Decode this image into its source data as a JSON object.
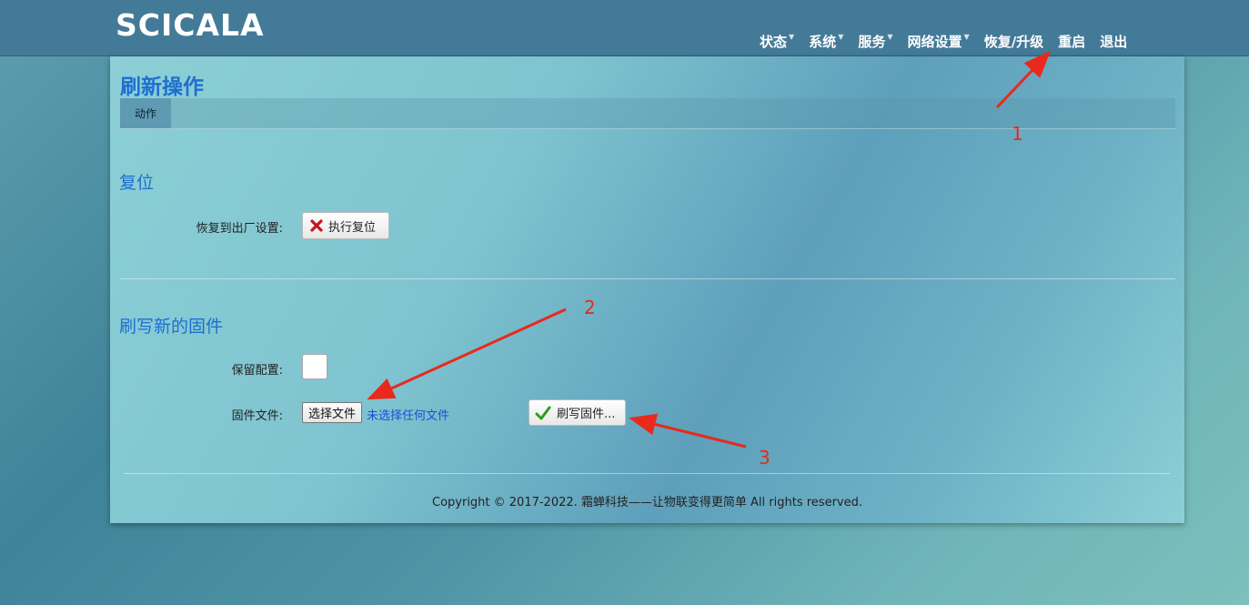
{
  "header": {
    "brand": "SCICALA",
    "nav": [
      {
        "label": "状态",
        "has_dropdown": true
      },
      {
        "label": "系统",
        "has_dropdown": true
      },
      {
        "label": "服务",
        "has_dropdown": true
      },
      {
        "label": "网络设置",
        "has_dropdown": true
      },
      {
        "label": "恢复/升级",
        "has_dropdown": false
      },
      {
        "label": "重启",
        "has_dropdown": false
      },
      {
        "label": "退出",
        "has_dropdown": false
      }
    ],
    "caret": "▼"
  },
  "page": {
    "title": "刷新操作",
    "tab": "动作"
  },
  "reset": {
    "title": "复位",
    "label": "恢复到出厂设置:",
    "button": "执行复位"
  },
  "flash": {
    "title": "刷写新的固件",
    "keep_label": "保留配置:",
    "file_label": "固件文件:",
    "choose_button": "选择文件",
    "file_status": "未选择任何文件",
    "flash_button": "刷写固件..."
  },
  "footer": "Copyright © 2017-2022. 霜蝉科技——让物联变得更简单 All rights reserved.",
  "annotations": [
    "1",
    "2",
    "3"
  ],
  "colors": {
    "accent": "#1e6fd0",
    "annotation": "#e8291c",
    "topbar": "#437a98"
  }
}
